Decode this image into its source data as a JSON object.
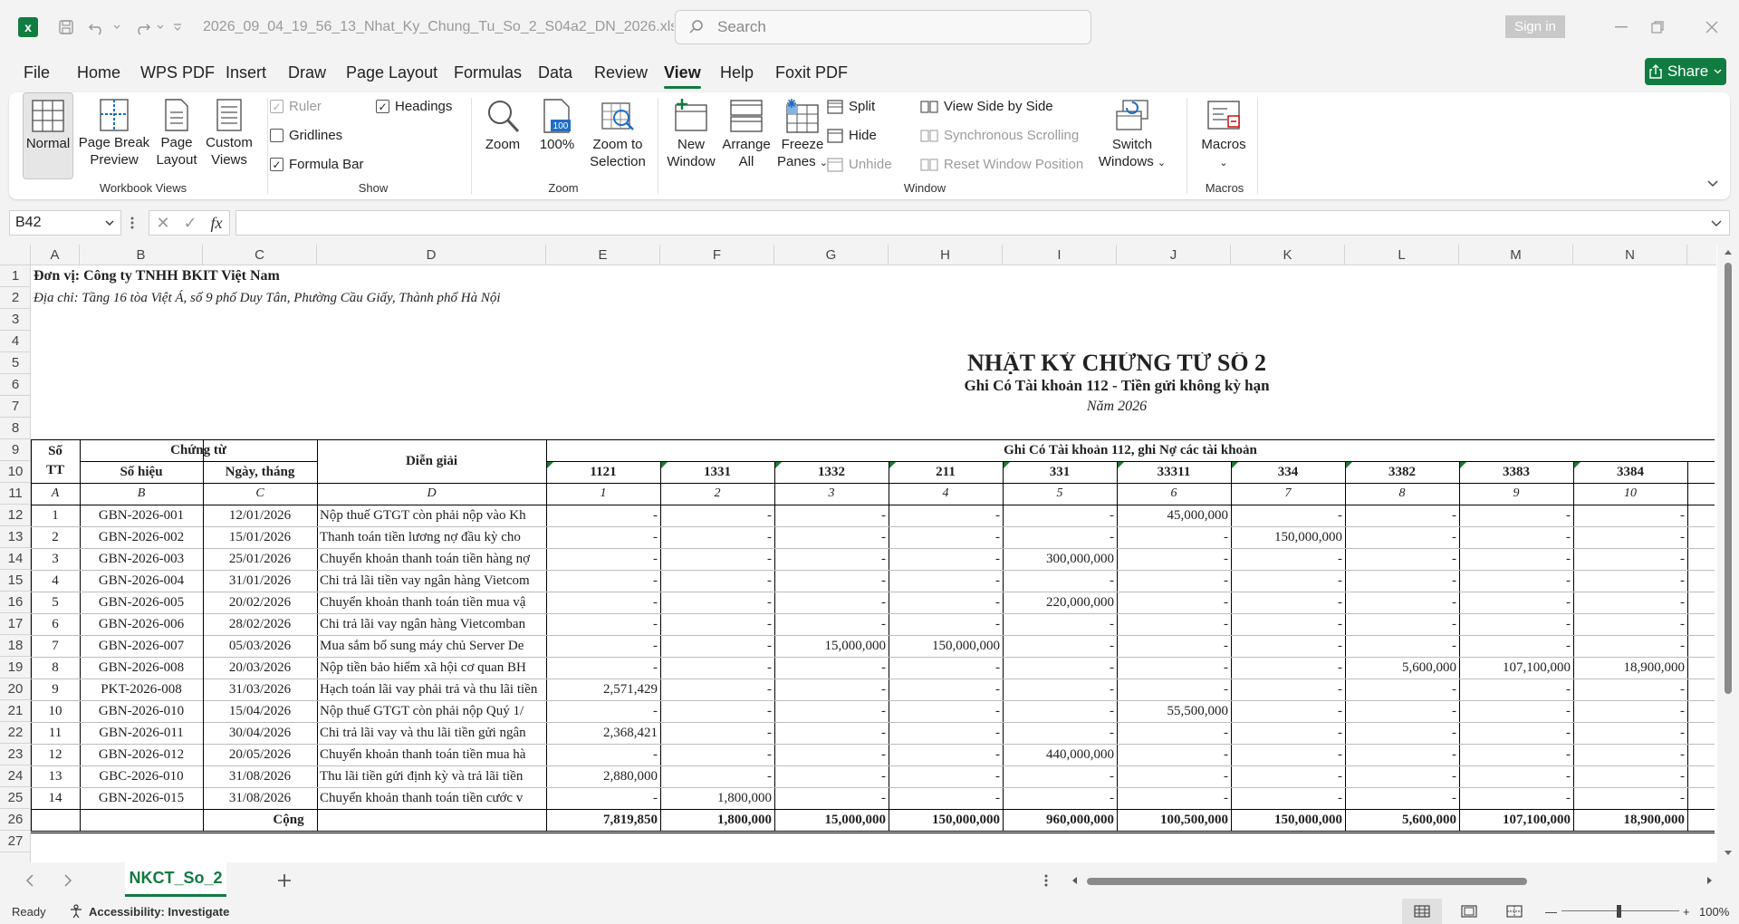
{
  "titlebar": {
    "doc_title": "2026_09_04_19_56_13_Nhat_Ky_Chung_Tu_So_2_S04a2_DN_2026.xlsx  -  E...",
    "search_placeholder": "Search",
    "signin_label": "Sign in"
  },
  "menu": {
    "tabs": [
      "File",
      "Home",
      "WPS PDF",
      "Insert",
      "Draw",
      "Page Layout",
      "Formulas",
      "Data",
      "Review",
      "View",
      "Help",
      "Foxit PDF"
    ],
    "active": "View",
    "share_label": "Share"
  },
  "ribbon": {
    "workbook_views": {
      "label": "Workbook Views",
      "normal": "Normal",
      "page_break_1": "Page Break",
      "page_break_2": "Preview",
      "page_layout_1": "Page",
      "page_layout_2": "Layout",
      "custom_1": "Custom",
      "custom_2": "Views"
    },
    "show": {
      "label": "Show",
      "ruler": "Ruler",
      "gridlines": "Gridlines",
      "formula_bar": "Formula Bar",
      "headings": "Headings",
      "ruler_checked": true,
      "gridlines_checked": false,
      "formula_bar_checked": true,
      "headings_checked": true
    },
    "zoom": {
      "label": "Zoom",
      "zoom": "Zoom",
      "hundred": "100%",
      "icon_100": "100",
      "zoom_sel_1": "Zoom to",
      "zoom_sel_2": "Selection"
    },
    "window": {
      "label": "Window",
      "new_1": "New",
      "new_2": "Window",
      "arrange_1": "Arrange",
      "arrange_2": "All",
      "freeze_1": "Freeze",
      "freeze_2": "Panes",
      "split": "Split",
      "hide": "Hide",
      "unhide": "Unhide",
      "side_by_side": "View Side by Side",
      "sync_scroll": "Synchronous Scrolling",
      "reset_pos": "Reset Window Position",
      "switch_1": "Switch",
      "switch_2": "Windows"
    },
    "macros": {
      "label": "Macros",
      "macros": "Macros"
    }
  },
  "formula_bar": {
    "namebox": "B42",
    "fx": "fx",
    "formula": ""
  },
  "sheet": {
    "columns": [
      "A",
      "B",
      "C",
      "D",
      "E",
      "F",
      "G",
      "H",
      "I",
      "J",
      "K",
      "L",
      "M",
      "N"
    ],
    "rows": [
      "1",
      "2",
      "3",
      "4",
      "5",
      "6",
      "7",
      "8",
      "9",
      "10",
      "11",
      "12",
      "13",
      "14",
      "15",
      "16",
      "17",
      "18",
      "19",
      "20",
      "21",
      "22",
      "23",
      "24",
      "25",
      "26",
      "27"
    ],
    "company": "Đơn vị: Công ty TNHH BKIT Việt Nam",
    "address": "Địa chỉ: Tầng 16 tòa Việt Á, số 9 phố Duy Tân, Phường Cầu Giấy, Thành phố Hà Nội",
    "title": "NHẬT KÝ CHỨNG TỪ SỐ 2",
    "subtitle": "Ghi Có Tài khoản 112 - Tiền gửi không kỳ hạn",
    "year": "Năm 2026",
    "h_stt_1": "Số",
    "h_stt_2": "TT",
    "h_chungtu": "Chứng từ",
    "h_sohieu": "Số hiệu",
    "h_ngay": "Ngày, tháng",
    "h_diengiai": "Diễn giải",
    "h_ghico": "Ghi Có Tài khoản 112, ghi Nợ các tài khoản",
    "accounts": [
      "1121",
      "1331",
      "1332",
      "211",
      "331",
      "33311",
      "334",
      "3382",
      "3383",
      "3384"
    ],
    "codes": [
      "A",
      "B",
      "C",
      "D",
      "1",
      "2",
      "3",
      "4",
      "5",
      "6",
      "7",
      "8",
      "9",
      "10"
    ],
    "data_rows": [
      [
        "1",
        "GBN-2026-001",
        "12/01/2026",
        "Nộp thuế GTGT còn phải nộp vào Kh",
        "-",
        "-",
        "-",
        "-",
        "-",
        "45,000,000",
        "-",
        "-",
        "-",
        "-"
      ],
      [
        "2",
        "GBN-2026-002",
        "15/01/2026",
        "Thanh toán tiền lương nợ đầu kỳ cho",
        "-",
        "-",
        "-",
        "-",
        "-",
        "-",
        "150,000,000",
        "-",
        "-",
        "-"
      ],
      [
        "3",
        "GBN-2026-003",
        "25/01/2026",
        "Chuyển khoản thanh toán tiền hàng nợ",
        "-",
        "-",
        "-",
        "-",
        "300,000,000",
        "-",
        "-",
        "-",
        "-",
        "-"
      ],
      [
        "4",
        "GBN-2026-004",
        "31/01/2026",
        "Chi trả lãi tiền vay ngân hàng Vietcom",
        "-",
        "-",
        "-",
        "-",
        "-",
        "-",
        "-",
        "-",
        "-",
        "-"
      ],
      [
        "5",
        "GBN-2026-005",
        "20/02/2026",
        "Chuyển khoản thanh toán tiền mua vậ",
        "-",
        "-",
        "-",
        "-",
        "220,000,000",
        "-",
        "-",
        "-",
        "-",
        "-"
      ],
      [
        "6",
        "GBN-2026-006",
        "28/02/2026",
        "Chi trả lãi vay ngân hàng Vietcomban",
        "-",
        "-",
        "-",
        "-",
        "-",
        "-",
        "-",
        "-",
        "-",
        "-"
      ],
      [
        "7",
        "GBN-2026-007",
        "05/03/2026",
        "Mua sắm bổ sung máy chủ Server De",
        "-",
        "-",
        "15,000,000",
        "150,000,000",
        "-",
        "-",
        "-",
        "-",
        "-",
        "-"
      ],
      [
        "8",
        "GBN-2026-008",
        "20/03/2026",
        "Nộp tiền bảo hiểm xã hội cơ quan BH",
        "-",
        "-",
        "-",
        "-",
        "-",
        "-",
        "-",
        "5,600,000",
        "107,100,000",
        "18,900,000"
      ],
      [
        "9",
        "PKT-2026-008",
        "31/03/2026",
        "Hạch toán lãi vay phải trả và thu lãi tiền",
        "2,571,429",
        "-",
        "-",
        "-",
        "-",
        "-",
        "-",
        "-",
        "-",
        "-"
      ],
      [
        "10",
        "GBN-2026-010",
        "15/04/2026",
        "Nộp thuế GTGT còn phải nộp Quý 1/",
        "-",
        "-",
        "-",
        "-",
        "-",
        "55,500,000",
        "-",
        "-",
        "-",
        "-"
      ],
      [
        "11",
        "GBN-2026-011",
        "30/04/2026",
        "Chi trả lãi vay và thu lãi tiền gửi ngân",
        "2,368,421",
        "-",
        "-",
        "-",
        "-",
        "-",
        "-",
        "-",
        "-",
        "-"
      ],
      [
        "12",
        "GBN-2026-012",
        "20/05/2026",
        "Chuyển khoản thanh toán tiền mua hà",
        "-",
        "-",
        "-",
        "-",
        "440,000,000",
        "-",
        "-",
        "-",
        "-",
        "-"
      ],
      [
        "13",
        "GBC-2026-010",
        "31/08/2026",
        "Thu lãi tiền gửi định kỳ và trả lãi tiền",
        "2,880,000",
        "-",
        "-",
        "-",
        "-",
        "-",
        "-",
        "-",
        "-",
        "-"
      ],
      [
        "14",
        "GBN-2026-015",
        "31/08/2026",
        "Chuyển khoản thanh toán tiền cước v",
        "-",
        "1,800,000",
        "-",
        "-",
        "-",
        "-",
        "-",
        "-",
        "-",
        "-"
      ]
    ],
    "total_label": "Cộng",
    "totals": [
      "7,819,850",
      "1,800,000",
      "15,000,000",
      "150,000,000",
      "960,000,000",
      "100,500,000",
      "150,000,000",
      "5,600,000",
      "107,100,000",
      "18,900,000"
    ]
  },
  "tabs": {
    "sheet_name": "NKCT_So_2"
  },
  "status": {
    "ready": "Ready",
    "accessibility": "Accessibility: Investigate",
    "zoom": "100%"
  }
}
